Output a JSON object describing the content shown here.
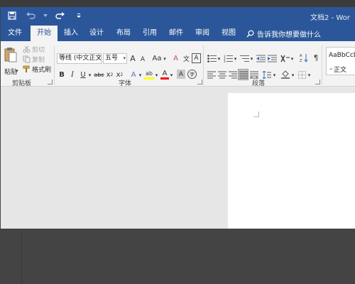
{
  "window": {
    "doc_title": "文档2 - Wor"
  },
  "quick_access": {
    "save": "save-icon",
    "undo": "undo-icon",
    "redo": "redo-icon",
    "customize": "customize-icon"
  },
  "tabs": [
    {
      "label": "文件"
    },
    {
      "label": "开始"
    },
    {
      "label": "插入"
    },
    {
      "label": "设计"
    },
    {
      "label": "布局"
    },
    {
      "label": "引用"
    },
    {
      "label": "邮件"
    },
    {
      "label": "审阅"
    },
    {
      "label": "视图"
    }
  ],
  "search": {
    "label": "告诉我你想要做什么"
  },
  "clipboard": {
    "paste": "粘贴",
    "cut": "剪切",
    "copy": "复制",
    "format_painter": "格式刷",
    "group": "剪贴板"
  },
  "font": {
    "font_name": "等线 (中文正文",
    "font_size": "五号",
    "group": "字体",
    "buttons": {
      "grow": "A",
      "shrink": "A",
      "case": "Aa",
      "clear": "A",
      "phonetic": "文",
      "border": "A",
      "bold": "B",
      "italic": "I",
      "underline": "U",
      "strike": "abc",
      "subscript": "x",
      "superscript": "x",
      "effects": "A",
      "highlight": "ab",
      "color": "A",
      "shading": "A",
      "enclose": "字"
    }
  },
  "paragraph": {
    "group": "段落"
  },
  "styles": {
    "normal_preview": "AaBbCcD",
    "normal_label": "正文"
  },
  "colors": {
    "accent": "#2b579a",
    "ribbon": "#f3f3f3",
    "workspace": "#e6e6e6",
    "highlight": "#ffff00",
    "font_color": "#ff0000"
  }
}
